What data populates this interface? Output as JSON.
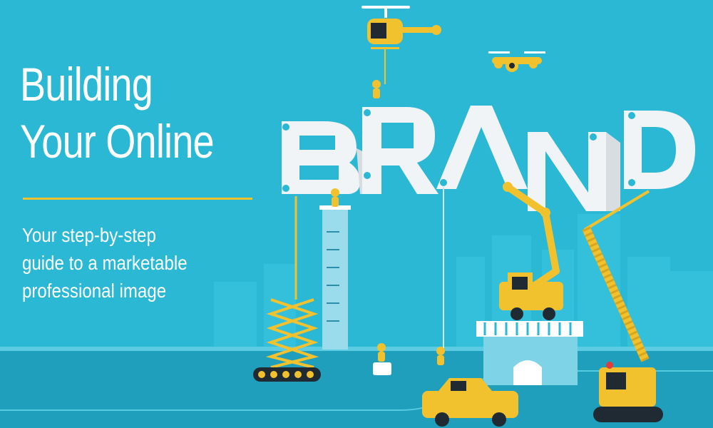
{
  "headline": {
    "line1": "Building",
    "line2": "Your Online"
  },
  "subheadline": {
    "line1": "Your step-by-step",
    "line2": "guide to a marketable",
    "line3": "professional image"
  },
  "brand_word": "BRAND",
  "colors": {
    "sky": "#2bb8d4",
    "letters": "#f1f4f6",
    "accent": "#f2c12e",
    "ground": "#1f9fbc",
    "road": "#1b8fab"
  },
  "icons": [
    "helicopter-icon",
    "drone-icon",
    "worker-icon",
    "scissor-lift-icon",
    "crane-truck-icon",
    "car-icon",
    "measure-tower-icon",
    "building-icon"
  ]
}
